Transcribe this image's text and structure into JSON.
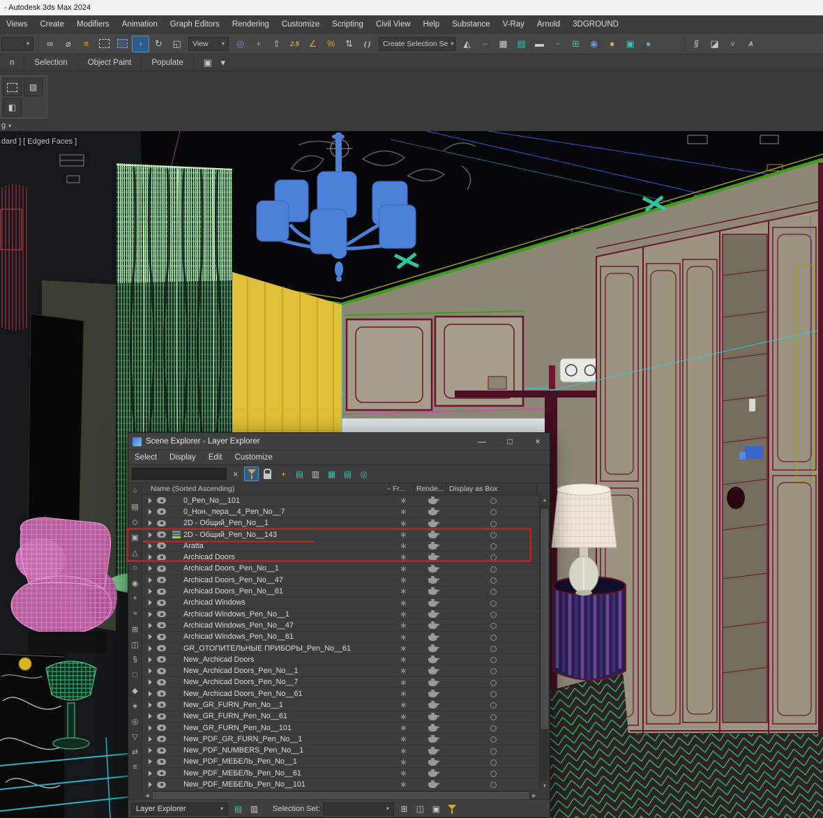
{
  "colors": {
    "annotation_red": "#d81616",
    "active_tool_bg": "#2e5c88",
    "selection_blue": "#4c80d8"
  },
  "titlebar": {
    "title": "- Autodesk 3ds Max 2024"
  },
  "menubar": {
    "items": [
      {
        "label": "Views"
      },
      {
        "label": "Create"
      },
      {
        "label": "Modifiers"
      },
      {
        "label": "Animation"
      },
      {
        "label": "Graph Editors"
      },
      {
        "label": "Rendering"
      },
      {
        "label": "Customize"
      },
      {
        "label": "Scripting"
      },
      {
        "label": "Civil View"
      },
      {
        "label": "Help"
      },
      {
        "label": "Substance"
      },
      {
        "label": "V-Ray"
      },
      {
        "label": "Arnold"
      },
      {
        "label": "3DGROUND"
      }
    ]
  },
  "main_toolbar": {
    "partial_value": "",
    "view_value": "View",
    "selection_set_value": "Create Selection Se",
    "caret": "▾",
    "icons_a": [
      {
        "name": "select-and-link-icon",
        "glyph": "∞"
      },
      {
        "name": "unlink-selection-icon",
        "glyph": "⌀"
      },
      {
        "name": "select-by-name-icon",
        "glyph": "≡",
        "tone": "gold"
      },
      {
        "name": "rectangular-selection-region-icon",
        "cls": "dashed"
      },
      {
        "name": "window-crossing-selection-icon",
        "cls": "dashed2",
        "tone": "blue"
      },
      {
        "name": "select-and-move-icon",
        "glyph": "+",
        "tone": "blue",
        "active": true
      },
      {
        "name": "select-and-rotate-icon",
        "glyph": "↻"
      },
      {
        "name": "select-and-scale-icon",
        "glyph": "◱"
      }
    ],
    "icons_b": [
      {
        "name": "use-pivot-point-center-icon",
        "glyph": "◎",
        "tone": "blue"
      },
      {
        "name": "select-and-manipulate-icon",
        "glyph": "+",
        "tone": "green"
      },
      {
        "name": "keyboard-shortcut-override-icon",
        "glyph": "⇧"
      },
      {
        "name": "snaps-toggle-icon",
        "glyph": "2.5",
        "small": true,
        "tone": "gold"
      },
      {
        "name": "angle-snap-toggle-icon",
        "glyph": "∠",
        "tone": "gold"
      },
      {
        "name": "percent-snap-toggle-icon",
        "glyph": "%",
        "tone": "gold"
      },
      {
        "name": "spinner-snap-toggle-icon",
        "glyph": "⇅"
      },
      {
        "name": "edit-named-selection-sets-icon",
        "glyph": "{ }",
        "small": true
      }
    ],
    "icons_c": [
      {
        "name": "mirror-icon",
        "glyph": "◭"
      },
      {
        "name": "align-icon",
        "glyph": "⇔",
        "tone": "blue"
      },
      {
        "name": "toggle-scene-explorer-icon",
        "glyph": "▦"
      },
      {
        "name": "toggle-layer-explorer-icon",
        "glyph": "▤",
        "tone": "teal"
      },
      {
        "name": "toggle-ribbon-icon",
        "glyph": "▬"
      },
      {
        "name": "curve-editor-icon",
        "glyph": "~",
        "tone": "teal"
      },
      {
        "name": "schematic-view-icon",
        "glyph": "⊞",
        "tone": "teal"
      },
      {
        "name": "material-editor-icon",
        "glyph": "◉",
        "tone": "blue"
      },
      {
        "name": "render-setup-icon",
        "glyph": "●",
        "tone": "gold"
      },
      {
        "name": "rendered-frame-window-icon",
        "glyph": "▣",
        "tone": "teal"
      },
      {
        "name": "render-production-icon",
        "glyph": "●",
        "tone": "blue"
      }
    ],
    "icons_d": [
      {
        "name": "substance-icon",
        "glyph": "§"
      },
      {
        "name": "bake-to-texture-icon",
        "glyph": "◪"
      },
      {
        "name": "vray-toolbar-icon",
        "glyph": "V",
        "small": true,
        "tone": "blue"
      },
      {
        "name": "arnold-toolbar-icon",
        "glyph": "A",
        "small": true
      }
    ]
  },
  "ribbon": {
    "tabs": [
      {
        "label": "n"
      },
      {
        "label": "Selection"
      },
      {
        "label": "Object Paint"
      },
      {
        "label": "Populate"
      }
    ],
    "icons": [
      {
        "name": "ribbon-window-icon",
        "glyph": "▣"
      },
      {
        "name": "ribbon-caret-icon",
        "glyph": "▾"
      }
    ]
  },
  "mini_panel": {
    "buttons": [
      {
        "name": "paint-select-region-icon",
        "cls": "dashed"
      },
      {
        "name": "paint-deform-icon",
        "glyph": "▨",
        "tone": "blue"
      },
      {
        "name": "paint-fill-icon",
        "glyph": "◧",
        "tone": "blue"
      }
    ],
    "caption": "g",
    "caret": "▾"
  },
  "viewport": {
    "label": "dard ] [ Edged Faces ]"
  },
  "scene_explorer": {
    "title": "Scene Explorer - Layer Explorer",
    "controls": {
      "minimize": "—",
      "maximize": "□",
      "close": "×"
    },
    "menu": [
      {
        "label": "Select"
      },
      {
        "label": "Display"
      },
      {
        "label": "Edit"
      },
      {
        "label": "Customize"
      }
    ],
    "search": {
      "value": ""
    },
    "toolbar_icons": [
      {
        "name": "clear-search-icon",
        "glyph": "×"
      },
      {
        "name": "filter-funnel-icon",
        "cls": "funnel",
        "tone": "gold",
        "active": true
      },
      {
        "name": "lock-cell-editing-icon",
        "cls": "lock"
      },
      {
        "name": "create-new-layer-icon",
        "glyph": "+",
        "tone": "gold"
      },
      {
        "name": "add-selection-to-new-layer-icon",
        "glyph": "▤",
        "tone": "teal"
      },
      {
        "name": "add-selection-to-highlighted-layer-icon",
        "glyph": "▥"
      },
      {
        "name": "select-highlighted-objects-layers-icon",
        "glyph": "▦",
        "tone": "teal"
      },
      {
        "name": "set-current-highlighted-layer-icon",
        "glyph": "▤",
        "tone": "teal"
      },
      {
        "name": "pick-object-set-layer-icon",
        "glyph": "◎",
        "tone": "teal"
      }
    ],
    "left_toolbar_icons": [
      {
        "name": "find-icon",
        "glyph": "○"
      },
      {
        "name": "layers-stack-icon",
        "glyph": "▤",
        "tone": "teal"
      },
      {
        "name": "pick-icon",
        "glyph": "◇"
      },
      {
        "name": "display-geometry-icon",
        "glyph": "▣"
      },
      {
        "name": "display-shapes-icon",
        "glyph": "△"
      },
      {
        "name": "display-lights-icon",
        "glyph": "☼",
        "tone": "gold"
      },
      {
        "name": "display-cameras-icon",
        "glyph": "◉"
      },
      {
        "name": "display-helpers-icon",
        "glyph": "+"
      },
      {
        "name": "display-spacewarps-icon",
        "glyph": "≈"
      },
      {
        "name": "display-groups-icon",
        "glyph": "⊞"
      },
      {
        "name": "display-xrefs-icon",
        "glyph": "◫"
      },
      {
        "name": "display-bones-icon",
        "glyph": "§"
      },
      {
        "name": "display-containers-icon",
        "glyph": "□"
      },
      {
        "name": "display-materials-icon",
        "glyph": "◆",
        "tone": "blue"
      },
      {
        "name": "display-frozen-icon",
        "glyph": "∗"
      },
      {
        "name": "display-hidden-icon",
        "glyph": "◎"
      },
      {
        "name": "filter-list-icon",
        "glyph": "▽",
        "tone": "gold"
      },
      {
        "name": "sync-selection-icon",
        "glyph": "⇄"
      },
      {
        "name": "explorer-settings-icon",
        "glyph": "≡"
      }
    ],
    "columns": {
      "name": "Name (Sorted Ascending)",
      "sort_glyph": "▲",
      "frozen": "Fr...",
      "render": "Rende...",
      "display_as_box": "Display as Box"
    },
    "rows": [
      {
        "name": "0_Pen_No__101"
      },
      {
        "name": "0_Нон._пера__4_Pen_No__7"
      },
      {
        "name": "2D - Общий_Pen_No__1"
      },
      {
        "name": "2D - Общий_Pen_No__143",
        "current": true
      },
      {
        "name": "Aratta"
      },
      {
        "name": "Archicad Doors"
      },
      {
        "name": "Archicad Doors_Pen_No__1"
      },
      {
        "name": "Archicad Doors_Pen_No__47"
      },
      {
        "name": "Archicad Doors_Pen_No__61"
      },
      {
        "name": "Archicad Windows"
      },
      {
        "name": "Archicad Windows_Pen_No__1"
      },
      {
        "name": "Archicad Windows_Pen_No__47"
      },
      {
        "name": "Archicad Windows_Pen_No__61"
      },
      {
        "name": "GR_ОТОПИТЕЛЬНЫЕ ПРИБОРЫ_Pen_No__61"
      },
      {
        "name": "New_Archicad Doors"
      },
      {
        "name": "New_Archicad Doors_Pen_No__1"
      },
      {
        "name": "New_Archicad Doors_Pen_No__7"
      },
      {
        "name": "New_Archicad Doors_Pen_No__61"
      },
      {
        "name": "New_GR_FURN_Pen_No__1"
      },
      {
        "name": "New_GR_FURN_Pen_No__61"
      },
      {
        "name": "New_GR_FURN_Pen_No__101"
      },
      {
        "name": "New_PDF_GR_FURN_Pen_No__1"
      },
      {
        "name": "New_PDF_NUMBERS_Pen_No__1"
      },
      {
        "name": "New_PDF_МЕБЕЛЬ_Pen_No__1"
      },
      {
        "name": "New_PDF_МЕБЕЛЬ_Pen_No__61"
      },
      {
        "name": "New_PDF_МЕБЕЛЬ_Pen_No__101"
      }
    ],
    "scrollbar": {
      "up": "▲",
      "down": "▼",
      "left": "◀",
      "right": "▶"
    },
    "footer": {
      "mode_value": "Layer Explorer",
      "caret": "▾",
      "selection_set_label": "Selection Set:",
      "selection_set_value": "",
      "left_icons": [
        {
          "name": "explorer-mode-layers-icon",
          "glyph": "▤",
          "tone": "teal"
        },
        {
          "name": "explorer-options-icon",
          "glyph": "▥"
        }
      ],
      "right_icons": [
        {
          "name": "create-selection-set-icon",
          "glyph": "⊞"
        },
        {
          "name": "named-sets-window-icon",
          "glyph": "◫"
        },
        {
          "name": "select-by-set-icon",
          "glyph": "▣"
        },
        {
          "name": "filter-selection-set-icon",
          "cls": "funnel",
          "tone": "gold"
        }
      ]
    }
  }
}
